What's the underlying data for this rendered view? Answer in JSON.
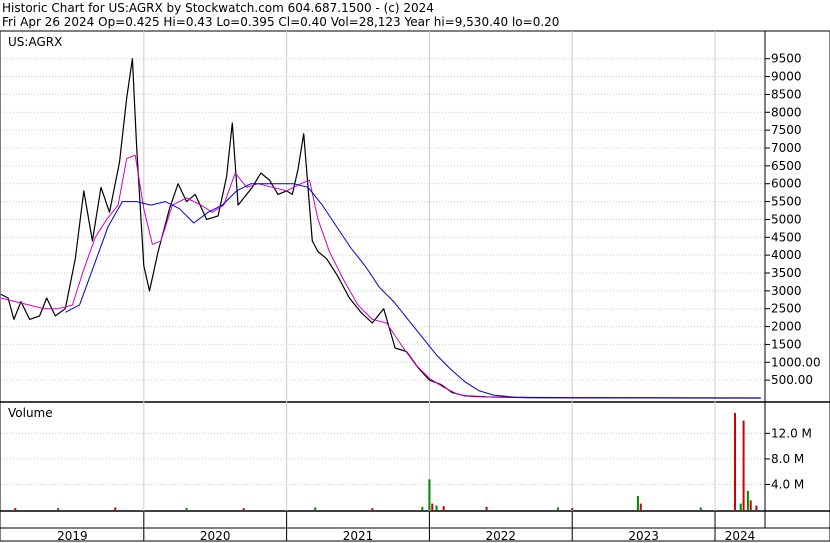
{
  "header": {
    "line1": "Historic Chart for US:AGRX by Stockwatch.com 604.687.1500 - (c) 2024",
    "line2": "Fri Apr 26 2024  Op=0.425  Hi=0.43  Lo=0.395  Cl=0.40  Vol=28,123  Year hi=9,530.40  lo=0.20"
  },
  "price_panel": {
    "label": "US:AGRX"
  },
  "volume_panel": {
    "label": "Volume"
  },
  "colors": {
    "price": "#000000",
    "ma_short": "#cc00cc",
    "ma_long": "#0000cc",
    "volume_up": "#008800",
    "volume_down": "#cc0000",
    "grid": "#cccccc"
  },
  "chart_data": [
    {
      "type": "line",
      "title": "US:AGRX",
      "x_ticks": [
        "2019",
        "2020",
        "2021",
        "2022",
        "2023",
        "2024"
      ],
      "y_ticks": [
        "9500",
        "9000",
        "8500",
        "8000",
        "7500",
        "7000",
        "6500",
        "6000",
        "5500",
        "5000",
        "4500",
        "4000",
        "3500",
        "3000",
        "2500",
        "2000",
        "1500",
        "1000.00",
        "500.00"
      ],
      "ylim": [
        0,
        9800
      ],
      "grid": true,
      "series": [
        {
          "values": [
            [
              2019.0,
              2900
            ],
            [
              2019.05,
              2800
            ],
            [
              2019.09,
              2200
            ],
            [
              2019.14,
              2700
            ],
            [
              2019.2,
              2200
            ],
            [
              2019.27,
              2300
            ],
            [
              2019.32,
              2800
            ],
            [
              2019.38,
              2300
            ],
            [
              2019.45,
              2500
            ],
            [
              2019.52,
              3900
            ],
            [
              2019.58,
              5800
            ],
            [
              2019.64,
              4400
            ],
            [
              2019.7,
              5900
            ],
            [
              2019.76,
              5200
            ],
            [
              2019.83,
              6600
            ],
            [
              2019.88,
              8400
            ],
            [
              2019.92,
              9500
            ],
            [
              2019.95,
              7000
            ],
            [
              2020.0,
              3700
            ],
            [
              2020.04,
              3000
            ],
            [
              2020.1,
              4100
            ],
            [
              2020.18,
              5300
            ],
            [
              2020.24,
              6000
            ],
            [
              2020.3,
              5500
            ],
            [
              2020.36,
              5700
            ],
            [
              2020.44,
              5000
            ],
            [
              2020.52,
              5100
            ],
            [
              2020.58,
              6200
            ],
            [
              2020.62,
              7700
            ],
            [
              2020.66,
              5400
            ],
            [
              2020.7,
              5600
            ],
            [
              2020.76,
              5900
            ],
            [
              2020.82,
              6300
            ],
            [
              2020.88,
              6100
            ],
            [
              2020.94,
              5700
            ],
            [
              2021.0,
              5800
            ],
            [
              2021.04,
              5700
            ],
            [
              2021.08,
              6400
            ],
            [
              2021.12,
              7400
            ],
            [
              2021.15,
              5900
            ],
            [
              2021.18,
              4400
            ],
            [
              2021.22,
              4100
            ],
            [
              2021.28,
              3900
            ],
            [
              2021.36,
              3400
            ],
            [
              2021.44,
              2800
            ],
            [
              2021.52,
              2400
            ],
            [
              2021.6,
              2100
            ],
            [
              2021.68,
              2500
            ],
            [
              2021.76,
              1400
            ],
            [
              2021.84,
              1300
            ],
            [
              2021.92,
              850
            ],
            [
              2022.0,
              500
            ],
            [
              2022.08,
              380
            ],
            [
              2022.16,
              150
            ],
            [
              2022.25,
              60
            ],
            [
              2022.4,
              30
            ],
            [
              2022.7,
              10
            ],
            [
              2023.0,
              5
            ],
            [
              2023.5,
              2
            ],
            [
              2024.0,
              1
            ],
            [
              2024.32,
              0.4
            ]
          ]
        },
        {
          "values": [
            [
              2019.0,
              2800
            ],
            [
              2019.1,
              2700
            ],
            [
              2019.2,
              2600
            ],
            [
              2019.3,
              2500
            ],
            [
              2019.4,
              2500
            ],
            [
              2019.5,
              2600
            ],
            [
              2019.58,
              3600
            ],
            [
              2019.66,
              4500
            ],
            [
              2019.74,
              5000
            ],
            [
              2019.82,
              5400
            ],
            [
              2019.88,
              6700
            ],
            [
              2019.94,
              6800
            ],
            [
              2020.0,
              5300
            ],
            [
              2020.06,
              4300
            ],
            [
              2020.12,
              4400
            ],
            [
              2020.2,
              5400
            ],
            [
              2020.3,
              5600
            ],
            [
              2020.4,
              5400
            ],
            [
              2020.48,
              5200
            ],
            [
              2020.56,
              5400
            ],
            [
              2020.64,
              6300
            ],
            [
              2020.72,
              5900
            ],
            [
              2020.8,
              6000
            ],
            [
              2020.9,
              5900
            ],
            [
              2021.0,
              5800
            ],
            [
              2021.1,
              6000
            ],
            [
              2021.16,
              6100
            ],
            [
              2021.22,
              5000
            ],
            [
              2021.3,
              4100
            ],
            [
              2021.4,
              3300
            ],
            [
              2021.5,
              2600
            ],
            [
              2021.6,
              2200
            ],
            [
              2021.7,
              2100
            ],
            [
              2021.8,
              1500
            ],
            [
              2021.9,
              950
            ],
            [
              2022.0,
              550
            ],
            [
              2022.1,
              300
            ],
            [
              2022.2,
              100
            ],
            [
              2022.3,
              40
            ],
            [
              2022.6,
              15
            ],
            [
              2023.0,
              5
            ],
            [
              2024.32,
              1
            ]
          ]
        },
        {
          "values": [
            [
              2019.45,
              2400
            ],
            [
              2019.55,
              2600
            ],
            [
              2019.65,
              3700
            ],
            [
              2019.75,
              4800
            ],
            [
              2019.85,
              5500
            ],
            [
              2019.95,
              5500
            ],
            [
              2020.05,
              5400
            ],
            [
              2020.15,
              5500
            ],
            [
              2020.25,
              5300
            ],
            [
              2020.35,
              4900
            ],
            [
              2020.45,
              5200
            ],
            [
              2020.55,
              5400
            ],
            [
              2020.65,
              5800
            ],
            [
              2020.75,
              6000
            ],
            [
              2020.85,
              6000
            ],
            [
              2020.95,
              6000
            ],
            [
              2021.05,
              6000
            ],
            [
              2021.15,
              5900
            ],
            [
              2021.25,
              5400
            ],
            [
              2021.35,
              4800
            ],
            [
              2021.45,
              4200
            ],
            [
              2021.55,
              3700
            ],
            [
              2021.65,
              3100
            ],
            [
              2021.75,
              2700
            ],
            [
              2021.85,
              2200
            ],
            [
              2021.95,
              1700
            ],
            [
              2022.05,
              1200
            ],
            [
              2022.15,
              800
            ],
            [
              2022.25,
              450
            ],
            [
              2022.35,
              200
            ],
            [
              2022.45,
              80
            ],
            [
              2022.6,
              20
            ],
            [
              2023.0,
              5
            ],
            [
              2024.32,
              1
            ]
          ]
        }
      ]
    },
    {
      "type": "bar",
      "title": "Volume",
      "y_ticks": [
        "12.0 M",
        "8.0 M",
        "4.0 M"
      ],
      "ylim": [
        0,
        15.5
      ],
      "series": [
        {
          "values": [
            [
              2019.1,
              0.3,
              "down"
            ],
            [
              2019.4,
              0.3,
              "up"
            ],
            [
              2019.8,
              0.4,
              "down"
            ],
            [
              2020.3,
              0.3,
              "up"
            ],
            [
              2020.7,
              0.3,
              "down"
            ],
            [
              2021.2,
              0.4,
              "up"
            ],
            [
              2021.6,
              0.3,
              "down"
            ],
            [
              2021.95,
              0.5,
              "up"
            ],
            [
              2022.0,
              4.8,
              "up"
            ],
            [
              2022.02,
              1.0,
              "down"
            ],
            [
              2022.05,
              0.7,
              "up"
            ],
            [
              2022.1,
              0.6,
              "down"
            ],
            [
              2022.4,
              0.5,
              "down"
            ],
            [
              2022.9,
              0.4,
              "up"
            ],
            [
              2023.0,
              0.3,
              "down"
            ],
            [
              2023.46,
              2.2,
              "up"
            ],
            [
              2023.48,
              1.0,
              "down"
            ],
            [
              2023.9,
              0.4,
              "up"
            ],
            [
              2024.14,
              15.2,
              "down"
            ],
            [
              2024.18,
              1.0,
              "up"
            ],
            [
              2024.2,
              14.0,
              "down"
            ],
            [
              2024.23,
              3.0,
              "up"
            ],
            [
              2024.25,
              1.5,
              "down"
            ],
            [
              2024.29,
              0.7,
              "down"
            ]
          ]
        }
      ]
    }
  ]
}
